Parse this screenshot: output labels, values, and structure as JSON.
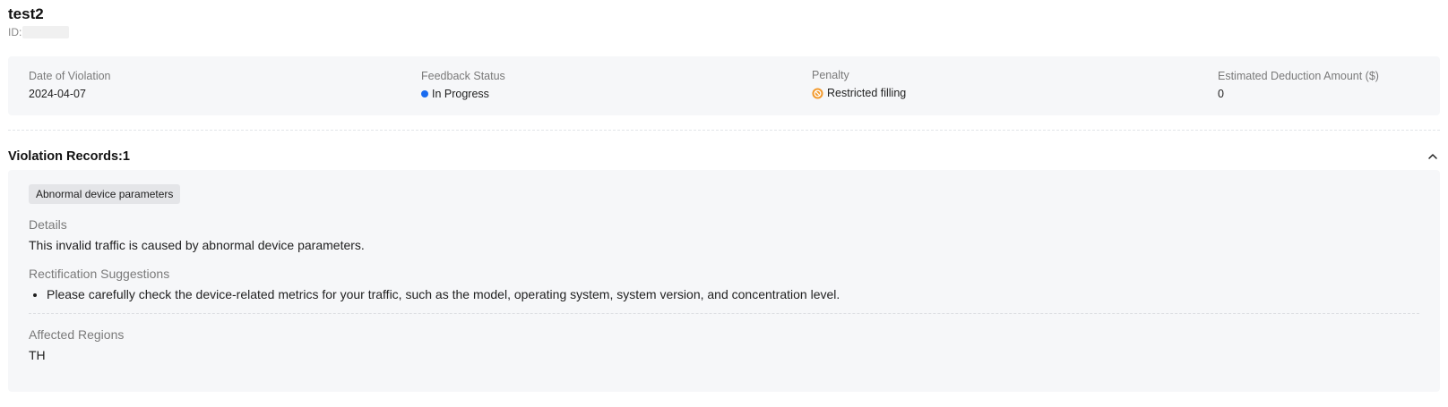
{
  "header": {
    "title": "test2",
    "id_label": "ID:"
  },
  "summary": {
    "date": {
      "label": "Date of Violation",
      "value": "2024-04-07"
    },
    "feedback": {
      "label": "Feedback Status",
      "value": "In Progress",
      "status_color": "#1a6cf0",
      "icon": "status-dot"
    },
    "penalty": {
      "label": "Penalty",
      "value": "Restricted filling",
      "icon_color": "#f29a2e",
      "icon": "ban-icon"
    },
    "deduction": {
      "label": "Estimated Deduction Amount ($)",
      "value": "0"
    }
  },
  "records": {
    "title": "Violation Records:1",
    "collapse_icon": "chevron-up-icon",
    "items": [
      {
        "tag": "Abnormal device parameters",
        "details_label": "Details",
        "details_text": "This invalid traffic is caused by abnormal device parameters.",
        "suggestions_label": "Rectification Suggestions",
        "suggestions": [
          "Please carefully check the device-related metrics for your traffic, such as the model, operating system, system version, and concentration level."
        ],
        "regions_label": "Affected Regions",
        "regions_value": "TH"
      }
    ]
  }
}
